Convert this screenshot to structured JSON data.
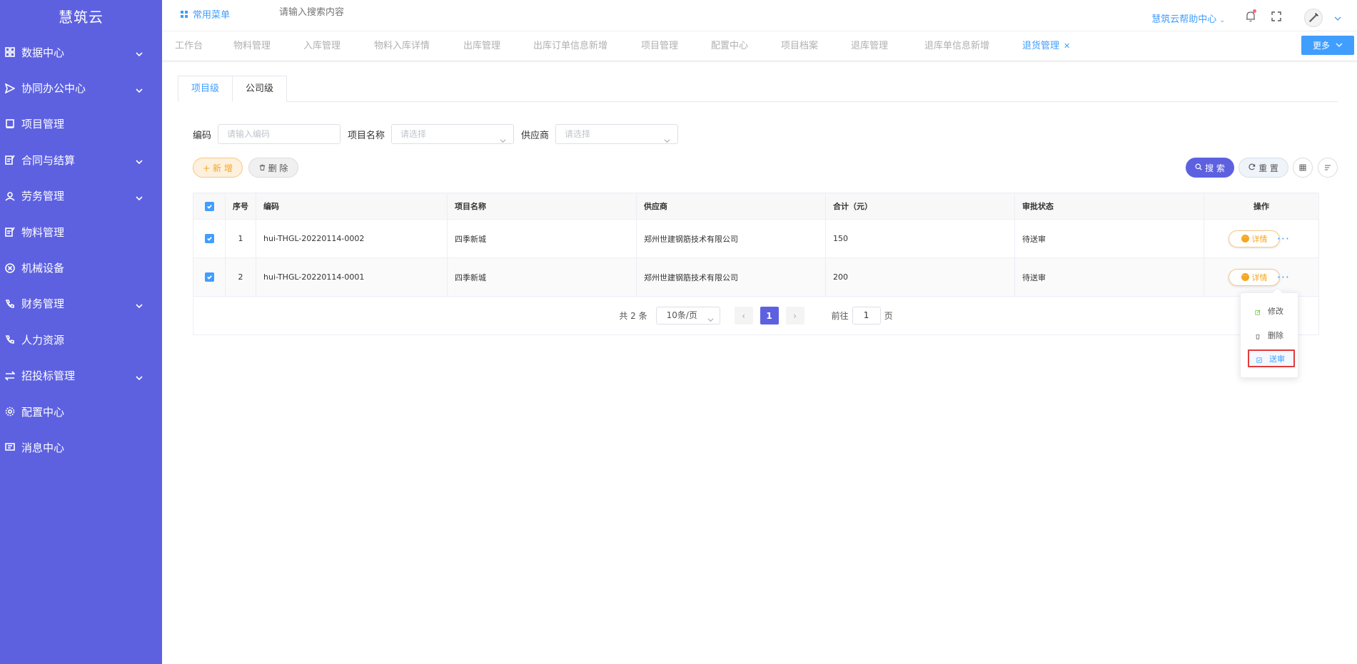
{
  "app": {
    "title": "慧筑云"
  },
  "sidebar": {
    "items": [
      {
        "label": "数据中心",
        "icon": "grid-icon",
        "expandable": true
      },
      {
        "label": "协同办公中心",
        "icon": "send-icon",
        "expandable": true
      },
      {
        "label": "项目管理",
        "icon": "book-icon",
        "expandable": false
      },
      {
        "label": "合同与结算",
        "icon": "edit-document-icon",
        "expandable": true
      },
      {
        "label": "劳务管理",
        "icon": "user-icon",
        "expandable": true
      },
      {
        "label": "物料管理",
        "icon": "edit-document-icon",
        "expandable": false
      },
      {
        "label": "机械设备",
        "icon": "close-circle-icon",
        "expandable": false
      },
      {
        "label": "财务管理",
        "icon": "phone-icon",
        "expandable": true
      },
      {
        "label": "人力资源",
        "icon": "phone-icon",
        "expandable": false
      },
      {
        "label": "招投标管理",
        "icon": "swap-icon",
        "expandable": true
      },
      {
        "label": "配置中心",
        "icon": "gear-icon",
        "expandable": false
      },
      {
        "label": "消息中心",
        "icon": "message-icon",
        "expandable": false
      }
    ]
  },
  "header": {
    "common_menu": "常用菜单",
    "search_placeholder": "请输入搜索内容",
    "help": "慧筑云帮助中心"
  },
  "tabs": [
    {
      "label": "工作台"
    },
    {
      "label": "物料管理"
    },
    {
      "label": "入库管理"
    },
    {
      "label": "物料入库详情"
    },
    {
      "label": "出库管理"
    },
    {
      "label": "出库订单信息新增"
    },
    {
      "label": "项目管理"
    },
    {
      "label": "配置中心"
    },
    {
      "label": "项目档案"
    },
    {
      "label": "退库管理"
    },
    {
      "label": "退库单信息新增"
    },
    {
      "label": "退货管理",
      "active": true
    }
  ],
  "more_button": "更多",
  "subtabs": [
    {
      "label": "项目级",
      "active": true
    },
    {
      "label": "公司级"
    }
  ],
  "filters": {
    "code_label": "编码",
    "code_placeholder": "请输入编码",
    "project_label": "项目名称",
    "project_placeholder": "请选择",
    "supplier_label": "供应商",
    "supplier_placeholder": "请选择"
  },
  "actions": {
    "add": "+ 新 增",
    "delete": "删 除",
    "search": "搜 索",
    "reset": "重 置"
  },
  "table": {
    "headers": [
      "序号",
      "编码",
      "项目名称",
      "供应商",
      "合计（元）",
      "审批状态",
      "操作"
    ],
    "rows": [
      {
        "no": "1",
        "code": "hui-THGL-20220114-0002",
        "project": "四季新城",
        "supplier": "郑州世建钢筋技术有限公司",
        "total": "150",
        "status": "待送审",
        "checked": true
      },
      {
        "no": "2",
        "code": "hui-THGL-20220114-0001",
        "project": "四季新城",
        "supplier": "郑州世建钢筋技术有限公司",
        "total": "200",
        "status": "待送审",
        "checked": true
      }
    ],
    "detail_label": "详情"
  },
  "pager": {
    "total": "共 2 条",
    "page_size": "10条/页",
    "current": "1",
    "goto_prefix": "前往",
    "goto_value": "1",
    "goto_suffix": "页"
  },
  "dropdown": {
    "items": [
      {
        "label": "修改",
        "icon": "edit-icon"
      },
      {
        "label": "删除",
        "icon": "trash-icon"
      },
      {
        "label": "送审",
        "icon": "submit-icon",
        "highlighted": true
      }
    ]
  },
  "colors": {
    "sidebar_bg": "#5d61e0",
    "primary": "#409eff",
    "accent_orange": "#f5a623",
    "highlight_border": "#e23b3b"
  }
}
